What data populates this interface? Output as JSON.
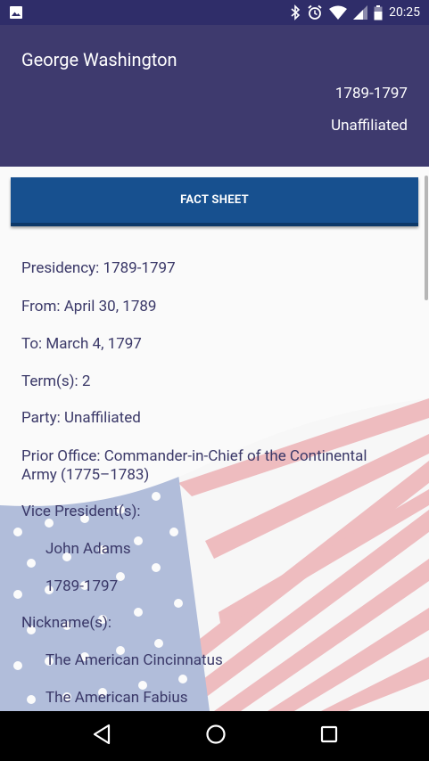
{
  "status_bar": {
    "time": "20:25",
    "icons": [
      "image-icon",
      "bluetooth-icon",
      "alarm-icon",
      "wifi-icon",
      "signal-icon",
      "battery-icon"
    ]
  },
  "header": {
    "name": "George Washington",
    "years": "1789-1797",
    "party": "Unaffiliated"
  },
  "fact_sheet_button": "FACT SHEET",
  "facts": {
    "presidency": "Presidency: 1789-1797",
    "from": "From: April 30, 1789",
    "to": "To: March 4, 1797",
    "terms": "Term(s): 2",
    "party": "Party: Unaffiliated",
    "prior_office": "Prior Office: Commander-in-Chief of the Continental Army (1775–1783)",
    "vp_label": "Vice President(s):",
    "vp_name": "John Adams",
    "vp_years": "1789-1797",
    "nicknames_label": "Nickname(s):",
    "nickname_1": "The American Cincinnatus",
    "nickname_2": "The American Fabius"
  },
  "colors": {
    "status_bar": "#2f2d69",
    "header": "#3e3a6e",
    "button": "#17508f",
    "text": "#3a3868"
  },
  "nav_icons": [
    "back-icon",
    "home-icon",
    "recents-icon"
  ]
}
